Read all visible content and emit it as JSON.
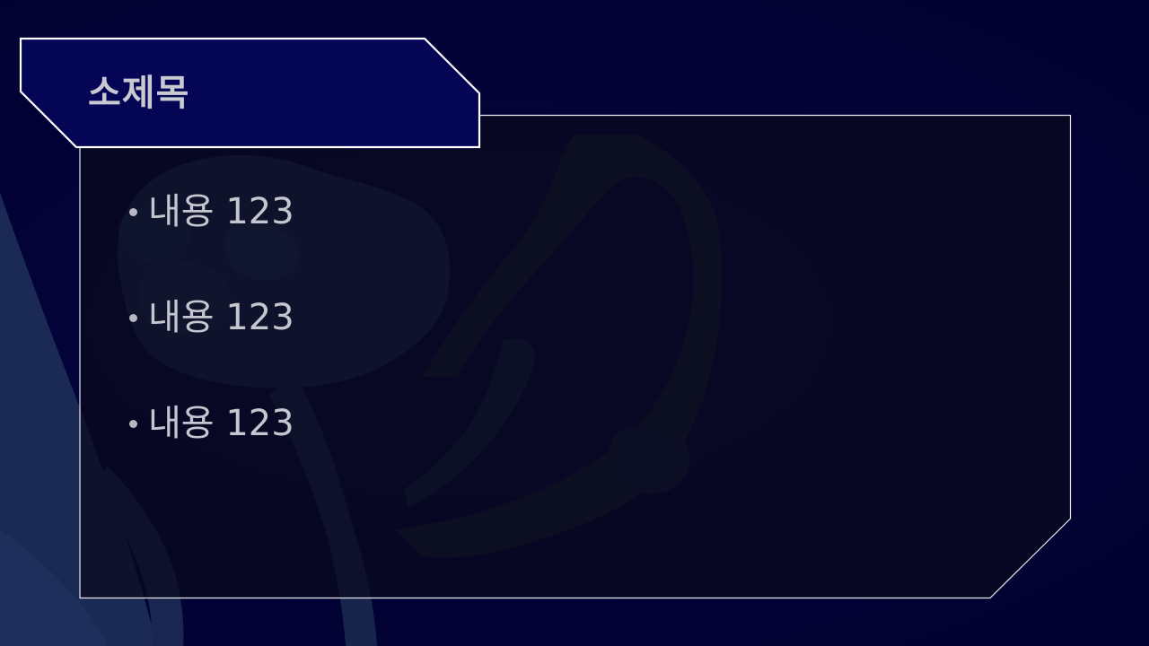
{
  "slide": {
    "title": "소제목",
    "bullets": [
      {
        "text": "내용 123"
      },
      {
        "text": "내용 123"
      },
      {
        "text": "내용 123"
      }
    ]
  },
  "colors": {
    "background": "#020236",
    "title_box_fill": "#050556",
    "panel_fill": "#0b0a1c",
    "frame_stroke": "#e8e8f0",
    "silhouette": "#1c2c56",
    "text": "#c6c6d0"
  }
}
